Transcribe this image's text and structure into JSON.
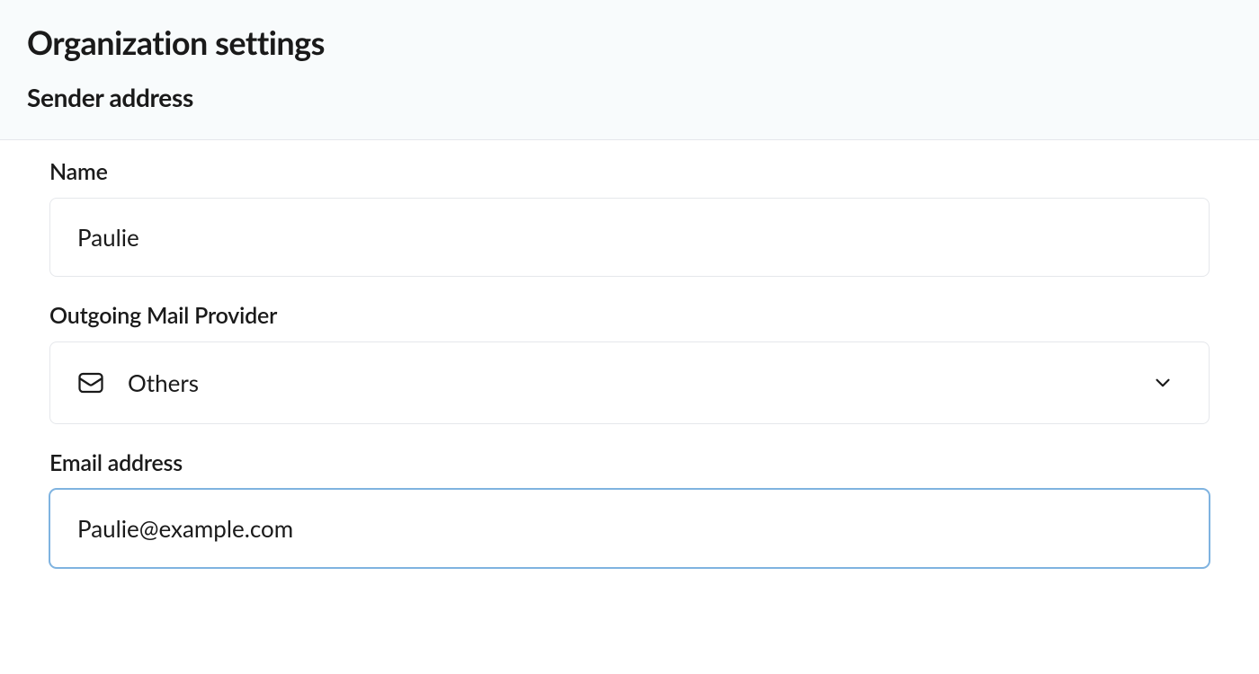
{
  "header": {
    "page_title": "Organization settings",
    "section_title": "Sender address"
  },
  "form": {
    "name": {
      "label": "Name",
      "value": "Paulie"
    },
    "provider": {
      "label": "Outgoing Mail Provider",
      "selected": "Others"
    },
    "email": {
      "label": "Email address",
      "value": "Paulie@example.com"
    }
  }
}
